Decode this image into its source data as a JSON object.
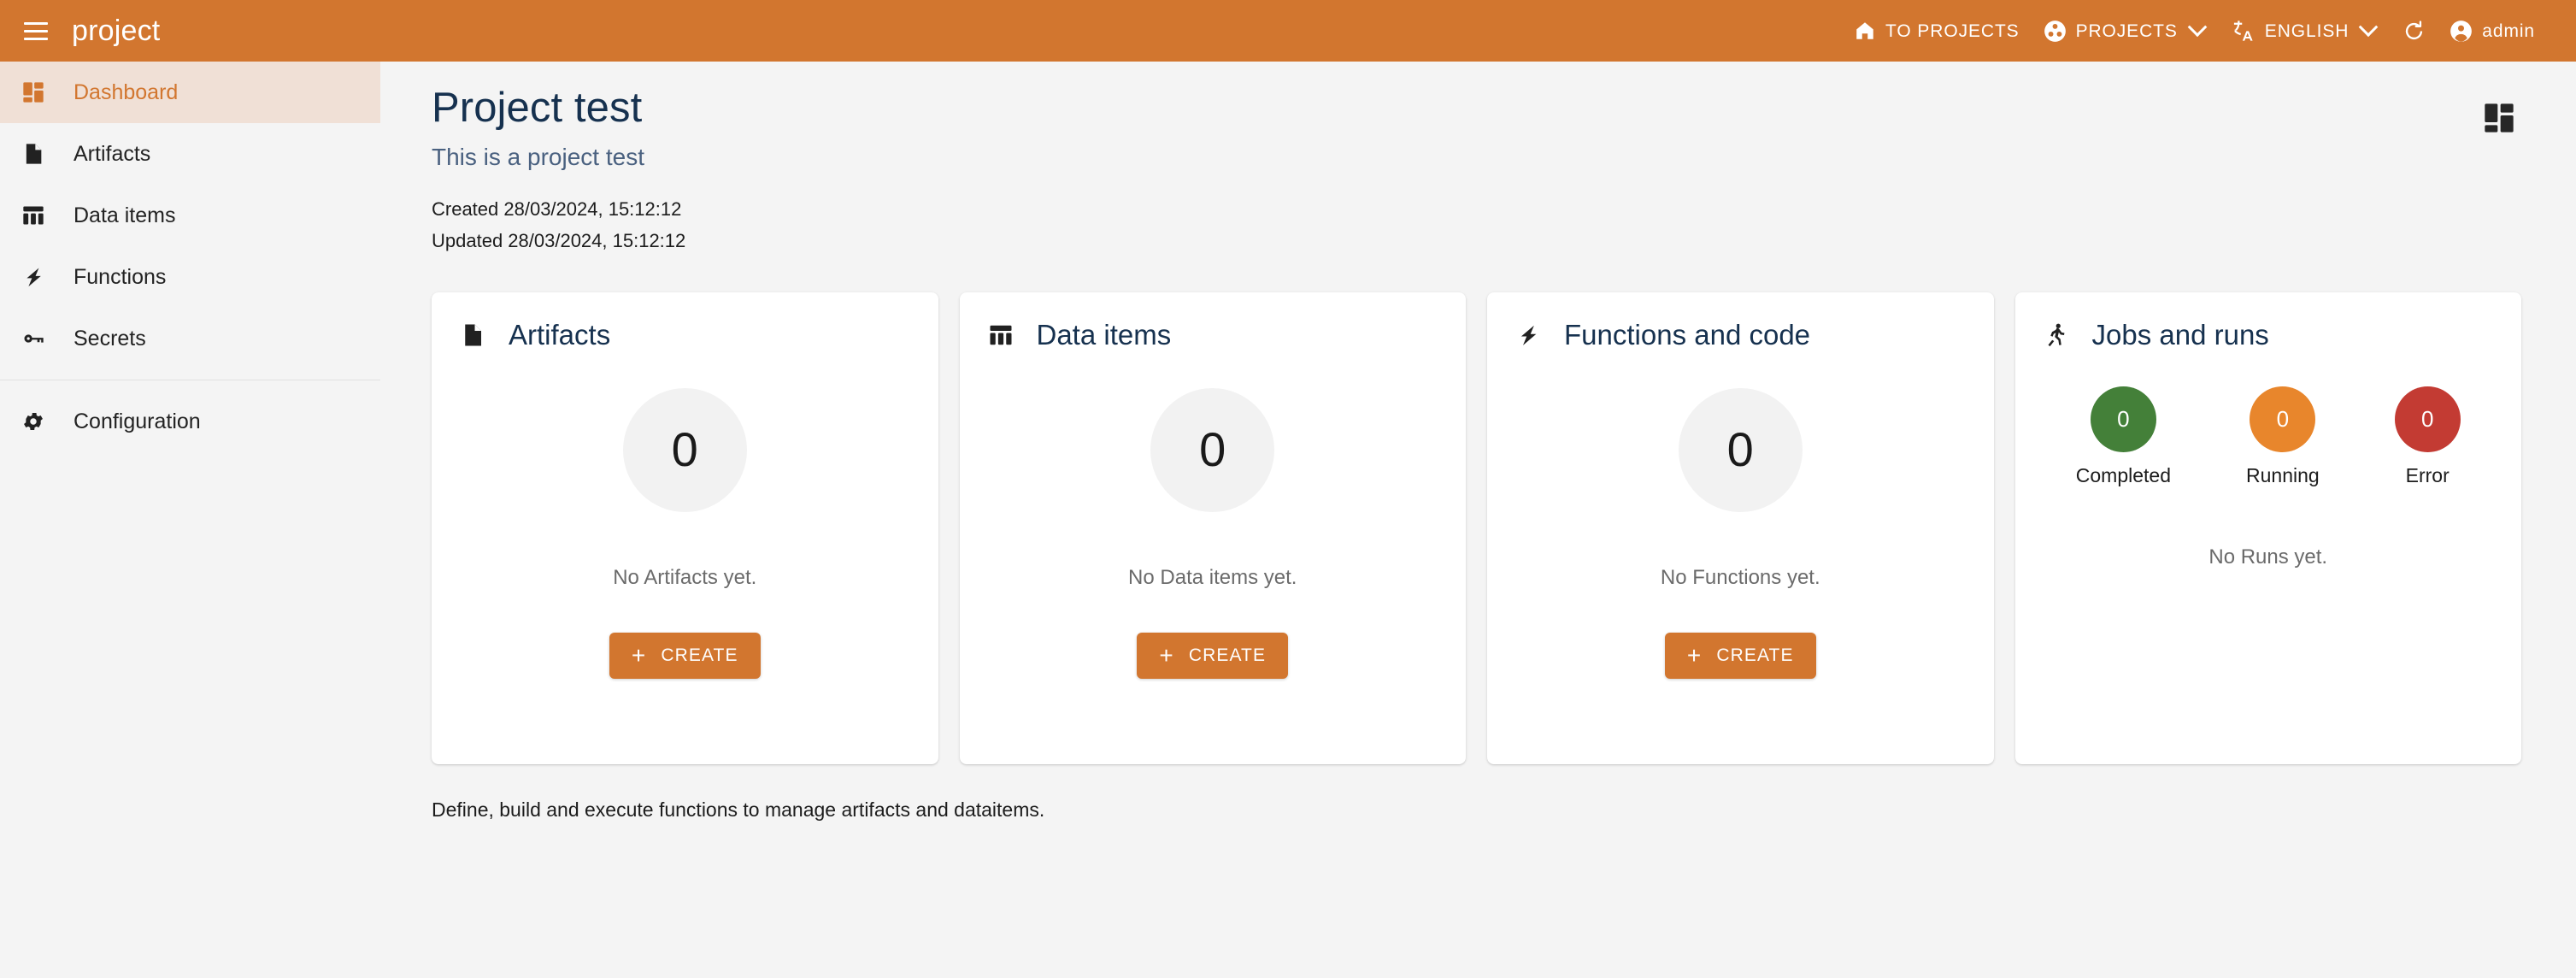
{
  "header": {
    "menu_icon": "hamburger-menu-icon",
    "app_title": "project",
    "to_projects": {
      "icon": "home-icon",
      "label": "TO PROJECTS"
    },
    "projects": {
      "icon": "projects-icon",
      "label": "PROJECTS",
      "chevron": "chevron-down-icon"
    },
    "language": {
      "icon": "translate-icon",
      "label": "ENGLISH",
      "chevron": "chevron-down-icon"
    },
    "refresh": {
      "icon": "refresh-icon"
    },
    "account": {
      "icon": "account-circle-icon",
      "label": "admin"
    },
    "background_color": "#d2762f"
  },
  "sidebar": {
    "items": [
      {
        "label": "Dashboard",
        "icon": "dashboard-grid-icon",
        "active": true
      },
      {
        "label": "Artifacts",
        "icon": "file-document-icon",
        "active": false
      },
      {
        "label": "Data items",
        "icon": "table-columns-icon",
        "active": false
      },
      {
        "label": "Functions",
        "icon": "lightning-bolt-icon",
        "active": false
      },
      {
        "label": "Secrets",
        "icon": "key-icon",
        "active": false
      }
    ],
    "footer_items": [
      {
        "label": "Configuration",
        "icon": "gear-icon",
        "active": false
      }
    ],
    "active_color": "#d2762f",
    "active_background": "#f0e0d6"
  },
  "main": {
    "title": "Project test",
    "subtitle": "This is a project test",
    "created": "Created 28/03/2024, 15:12:12",
    "updated": "Updated 28/03/2024, 15:12:12",
    "view_toggle_icon": "dashboard-grid-icon",
    "footer_note": "Define, build and execute functions to manage artifacts and dataitems."
  },
  "cards": [
    {
      "title": "Artifacts",
      "icon": "file-document-icon",
      "count": "0",
      "empty_text": "No Artifacts yet.",
      "create_label": "CREATE",
      "create_plus": "+"
    },
    {
      "title": "Data items",
      "icon": "table-columns-icon",
      "count": "0",
      "empty_text": "No Data items yet.",
      "create_label": "CREATE",
      "create_plus": "+"
    },
    {
      "title": "Functions and code",
      "icon": "lightning-bolt-icon",
      "count": "0",
      "empty_text": "No Functions yet.",
      "create_label": "CREATE",
      "create_plus": "+"
    }
  ],
  "jobs_card": {
    "title": "Jobs and runs",
    "icon": "running-person-icon",
    "stats": [
      {
        "label": "Completed",
        "value": "0",
        "color": "#448039"
      },
      {
        "label": "Running",
        "value": "0",
        "color": "#e8862c"
      },
      {
        "label": "Error",
        "value": "0",
        "color": "#c33b33"
      }
    ],
    "empty_text": "No Runs yet."
  },
  "colors": {
    "accent": "#d2762f",
    "page_background": "#f4f4f4",
    "card_background": "#ffffff",
    "title_color": "#16314f",
    "subtitle_color": "#4a6180"
  }
}
